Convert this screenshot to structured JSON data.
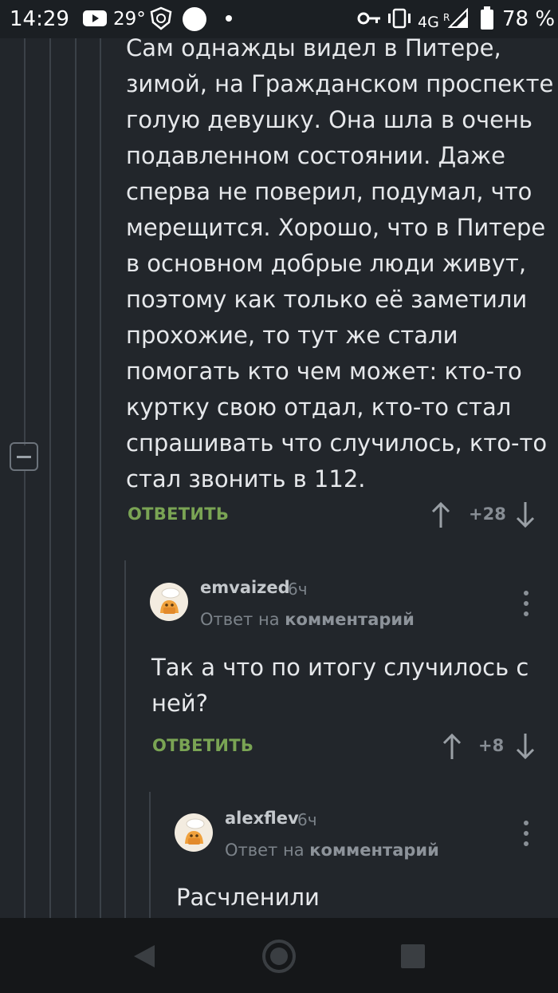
{
  "status_bar": {
    "time": "14:29",
    "temperature": "29°",
    "network": "4G",
    "network_sup": "R",
    "battery": "78 %"
  },
  "comments": [
    {
      "text_lines": [
        "Сам однажды видел в Питере,",
        "зимой, на Гражданском проспекте",
        "голую девушку. Она шла в очень",
        "подавленном состоянии. Даже",
        "сперва не поверил, подумал, что",
        "мерещится. Хорошо, что в Питере",
        "в основном добрые люди живут,",
        "поэтому как только её заметили",
        "прохожие, то тут же стали",
        "помогать кто чем может: кто-то",
        "куртку свою отдал, кто-то стал",
        "спрашивать что случилось, кто-то",
        "стал звонить в 112."
      ],
      "reply_label": "ОТВЕТИТЬ",
      "rating": "+28"
    },
    {
      "username": "emvaized",
      "time": "6ч",
      "reply_prefix": "Ответ на",
      "reply_target": "комментарий",
      "text_lines": [
        "Так а что по итогу случилось с",
        "ней?"
      ],
      "reply_label": "ОТВЕТИТЬ",
      "rating": "+8"
    },
    {
      "username": "alexflev",
      "time": "6ч",
      "reply_prefix": "Ответ на",
      "reply_target": "комментарий",
      "text_lines": [
        "Расчленили"
      ]
    }
  ],
  "colors": {
    "background": "#22262b",
    "accent_reply": "#7aa454",
    "muted": "#7c838a"
  },
  "icons": [
    "youtube-icon",
    "shield-app-icon",
    "circle-app-icon",
    "key-icon",
    "vibrate-icon",
    "signal-icon",
    "battery-icon",
    "upvote-icon",
    "downvote-icon",
    "more-vertical-icon",
    "back-icon",
    "home-icon",
    "recents-icon"
  ]
}
